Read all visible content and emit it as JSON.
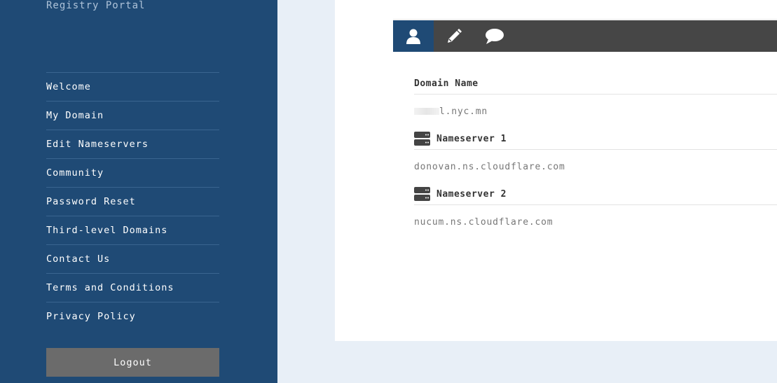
{
  "sidebar": {
    "portal_title": "Registry Portal",
    "nav": [
      {
        "label": "Welcome"
      },
      {
        "label": "My Domain"
      },
      {
        "label": "Edit Nameservers"
      },
      {
        "label": "Community"
      },
      {
        "label": "Password Reset"
      },
      {
        "label": "Third-level Domains"
      },
      {
        "label": "Contact Us"
      },
      {
        "label": "Terms and Conditions"
      },
      {
        "label": "Privacy Policy"
      }
    ],
    "logout_label": "Logout"
  },
  "tabs": [
    {
      "icon": "user-icon",
      "active": true
    },
    {
      "icon": "pencil-icon",
      "active": false
    },
    {
      "icon": "chat-bubble-icon",
      "active": false
    }
  ],
  "domain": {
    "label": "Domain Name",
    "value_visible": "l.nyc.mn"
  },
  "nameservers": [
    {
      "label": "Nameserver 1",
      "value": "donovan.ns.cloudflare.com",
      "icon": "server-icon"
    },
    {
      "label": "Nameserver 2",
      "value": "nucum.ns.cloudflare.com",
      "icon": "server-icon"
    }
  ],
  "colors": {
    "sidebar_bg": "#1f4a75",
    "tabbar_bg": "#464646",
    "active_tab_bg": "#1f4a75",
    "logout_bg": "#6b6b6b",
    "page_bg": "#e8eff7"
  }
}
